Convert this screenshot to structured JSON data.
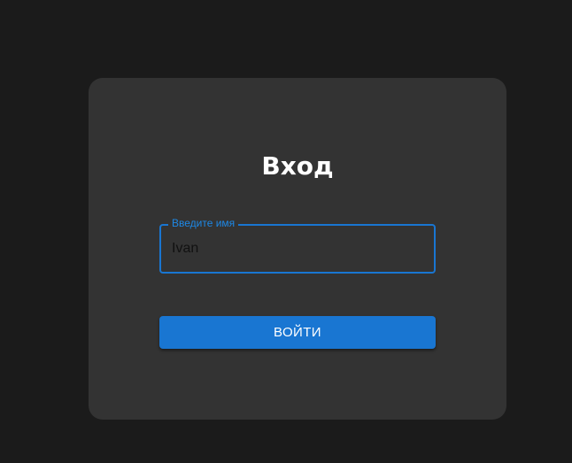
{
  "login": {
    "title": "Вход",
    "name_field": {
      "label": "Введите имя",
      "value": "Ivan"
    },
    "submit_label": "ВОЙТИ"
  },
  "colors": {
    "background": "#1b1b1b",
    "card": "#333333",
    "accent": "#1976d2",
    "label": "#1e88e5",
    "title_text": "#ffffff"
  }
}
